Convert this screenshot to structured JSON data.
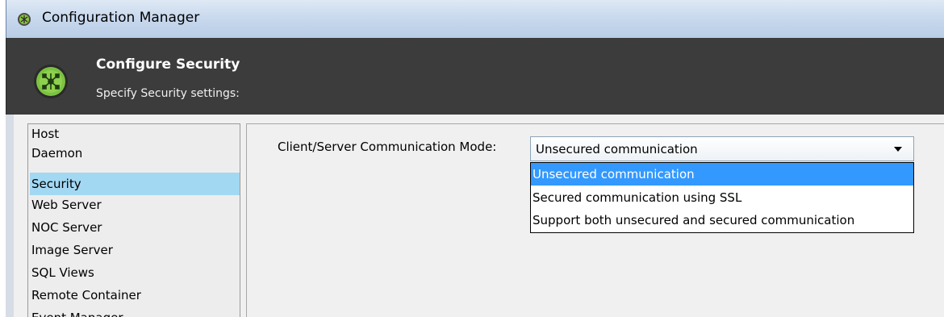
{
  "window": {
    "title": "Configuration Manager"
  },
  "header": {
    "title": "Configure Security",
    "subtitle": "Specify Security settings:"
  },
  "sidebar": {
    "items": [
      {
        "label": "Host",
        "selected": false
      },
      {
        "label": "Daemon",
        "selected": false
      },
      {
        "label": "Security",
        "selected": true
      },
      {
        "label": "Web Server",
        "selected": false
      },
      {
        "label": "NOC Server",
        "selected": false
      },
      {
        "label": "Image Server",
        "selected": false
      },
      {
        "label": "SQL Views",
        "selected": false
      },
      {
        "label": "Remote Container",
        "selected": false
      },
      {
        "label": "Event Manager",
        "selected": false
      }
    ]
  },
  "main": {
    "mode_label": "Client/Server Communication Mode:",
    "mode_select": {
      "value": "Unsecured communication",
      "options": [
        "Unsecured communication",
        "Secured communication using SSL",
        "Support both unsecured and secured communication"
      ]
    }
  },
  "colors": {
    "header_bg": "#3b3c3b",
    "selection_sidebar": "#a3d8f3",
    "selection_dropdown": "#3399ff",
    "brand_green": "#7cc242"
  }
}
